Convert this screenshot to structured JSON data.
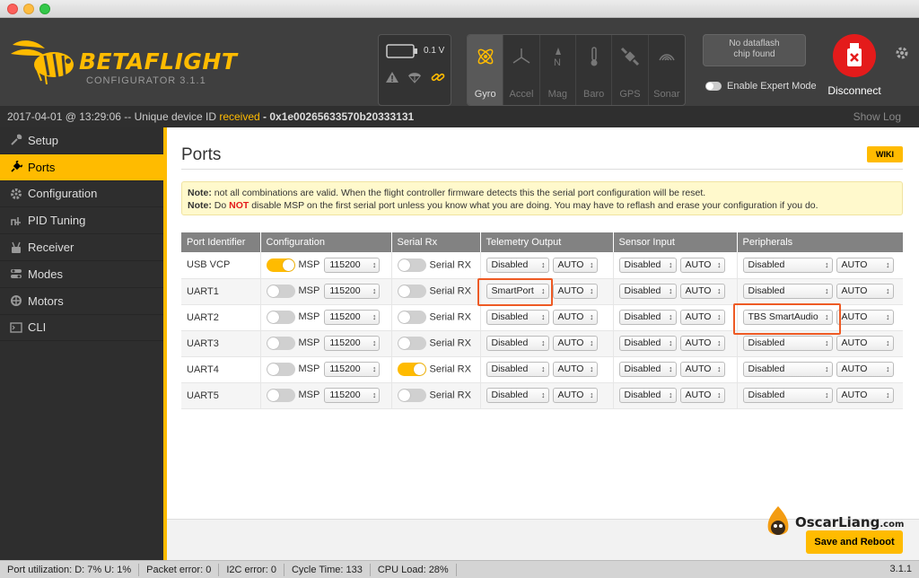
{
  "window": {
    "controls": [
      "close",
      "minimize",
      "maximize"
    ]
  },
  "header": {
    "logo_title": "BETAFLIGHT",
    "logo_subtitle": "CONFIGURATOR  3.1.1",
    "battery_voltage": "0.1 V",
    "sensors": [
      {
        "label": "Gyro",
        "active": true
      },
      {
        "label": "Accel",
        "active": false
      },
      {
        "label": "Mag",
        "active": false
      },
      {
        "label": "Baro",
        "active": false
      },
      {
        "label": "GPS",
        "active": false
      },
      {
        "label": "Sonar",
        "active": false
      }
    ],
    "dataflash_line1": "No dataflash",
    "dataflash_line2": "chip found",
    "expert_mode_label": "Enable Expert Mode",
    "disconnect_label": "Disconnect"
  },
  "logbar": {
    "prefix": "2017-04-01 @ 13:29:06 -- Unique device ID ",
    "received": "received",
    "device_id": " - 0x1e00265633570b20333131",
    "show_log": "Show Log"
  },
  "sidebar": {
    "items": [
      {
        "label": "Setup",
        "icon": "wrench-icon"
      },
      {
        "label": "Ports",
        "icon": "plug-icon",
        "active": true
      },
      {
        "label": "Configuration",
        "icon": "gear-icon"
      },
      {
        "label": "PID Tuning",
        "icon": "pid-icon"
      },
      {
        "label": "Receiver",
        "icon": "receiver-icon"
      },
      {
        "label": "Modes",
        "icon": "modes-icon"
      },
      {
        "label": "Motors",
        "icon": "motors-icon"
      },
      {
        "label": "CLI",
        "icon": "cli-icon"
      }
    ]
  },
  "main": {
    "title": "Ports",
    "wiki": "WIKI",
    "note1_bold": "Note:",
    "note1_text": " not all combinations are valid. When the flight controller firmware detects this the serial port configuration will be reset.",
    "note2_bold": "Note:",
    "note2_pre": " Do ",
    "note2_not": "NOT",
    "note2_text": " disable MSP on the first serial port unless you know what you are doing. You may have to reflash and erase your configuration if you do."
  },
  "table": {
    "headers": [
      "Port Identifier",
      "Configuration",
      "Serial Rx",
      "Telemetry Output",
      "Sensor Input",
      "Peripherals"
    ],
    "msp_label": "MSP",
    "serialrx_label": "Serial RX",
    "rows": [
      {
        "port": "USB VCP",
        "msp_on": true,
        "baud": "115200",
        "serialrx_on": false,
        "telemetry": "Disabled",
        "telemetry_baud": "AUTO",
        "sensor": "Disabled",
        "sensor_baud": "AUTO",
        "peripheral": "Disabled",
        "peripheral_baud": "AUTO"
      },
      {
        "port": "UART1",
        "msp_on": false,
        "baud": "115200",
        "serialrx_on": false,
        "telemetry": "SmartPort",
        "telemetry_baud": "AUTO",
        "sensor": "Disabled",
        "sensor_baud": "AUTO",
        "peripheral": "Disabled",
        "peripheral_baud": "AUTO"
      },
      {
        "port": "UART2",
        "msp_on": false,
        "baud": "115200",
        "serialrx_on": false,
        "telemetry": "Disabled",
        "telemetry_baud": "AUTO",
        "sensor": "Disabled",
        "sensor_baud": "AUTO",
        "peripheral": "TBS SmartAudio",
        "peripheral_baud": "AUTO"
      },
      {
        "port": "UART3",
        "msp_on": false,
        "baud": "115200",
        "serialrx_on": false,
        "telemetry": "Disabled",
        "telemetry_baud": "AUTO",
        "sensor": "Disabled",
        "sensor_baud": "AUTO",
        "peripheral": "Disabled",
        "peripheral_baud": "AUTO"
      },
      {
        "port": "UART4",
        "msp_on": false,
        "baud": "115200",
        "serialrx_on": true,
        "telemetry": "Disabled",
        "telemetry_baud": "AUTO",
        "sensor": "Disabled",
        "sensor_baud": "AUTO",
        "peripheral": "Disabled",
        "peripheral_baud": "AUTO"
      },
      {
        "port": "UART5",
        "msp_on": false,
        "baud": "115200",
        "serialrx_on": false,
        "telemetry": "Disabled",
        "telemetry_baud": "AUTO",
        "sensor": "Disabled",
        "sensor_baud": "AUTO",
        "peripheral": "Disabled",
        "peripheral_baud": "AUTO"
      }
    ]
  },
  "footer": {
    "save_label": "Save and Reboot",
    "watermark_main": "OscarLiang",
    "watermark_suffix": ".com"
  },
  "statusbar": {
    "port_util": "Port utilization: D: 7% U: 1%",
    "packet_error": "Packet error: 0",
    "i2c_error": "I2C error: 0",
    "cycle_time": "Cycle Time: 133",
    "cpu_load": "CPU Load: 28%",
    "version": "3.1.1"
  },
  "colors": {
    "accent": "#ffbb00",
    "disconnect": "#e41b1b",
    "highlight": "#ee5a24"
  }
}
